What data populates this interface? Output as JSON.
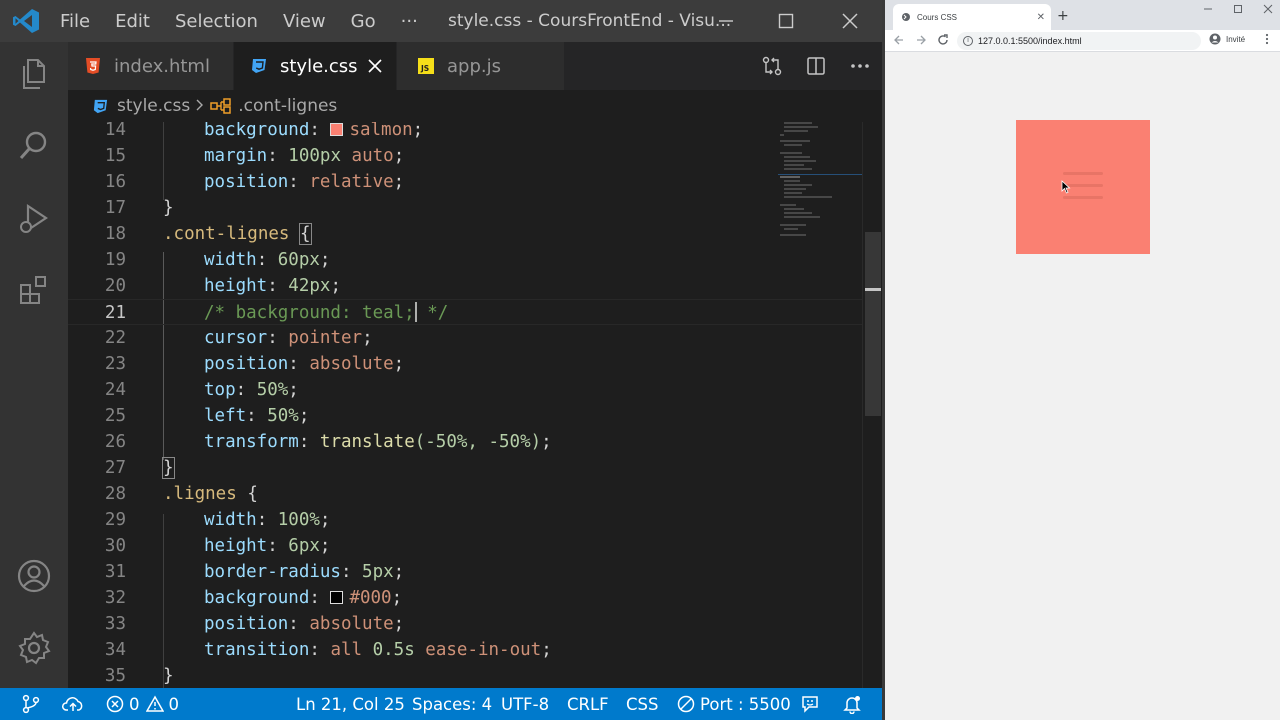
{
  "vscode": {
    "menu": [
      "File",
      "Edit",
      "Selection",
      "View",
      "Go",
      "···"
    ],
    "window_title": "style.css - CoursFrontEnd - Visu...",
    "tabs": [
      {
        "label": "index.html",
        "icon": "html-file-icon"
      },
      {
        "label": "style.css",
        "icon": "css-file-icon",
        "active": true
      },
      {
        "label": "app.js",
        "icon": "js-file-icon"
      }
    ],
    "breadcrumb": {
      "file": "style.css",
      "symbol": ".cont-lignes"
    },
    "line_numbers": [
      "14",
      "15",
      "16",
      "17",
      "18",
      "19",
      "20",
      "21",
      "22",
      "23",
      "24",
      "25",
      "26",
      "27",
      "28",
      "29",
      "30",
      "31",
      "32",
      "33",
      "34",
      "35"
    ],
    "code": {
      "l14": {
        "prop": "background",
        "val": "salmon"
      },
      "l15": {
        "prop": "margin",
        "num": "100px",
        "val": "auto"
      },
      "l16": {
        "prop": "position",
        "val": "relative"
      },
      "l17": {
        "brace": "}"
      },
      "l18": {
        "selector": ".cont-lignes",
        "brace": "{"
      },
      "l19": {
        "prop": "width",
        "num": "60px"
      },
      "l20": {
        "prop": "height",
        "num": "42px"
      },
      "l21": {
        "comment_a": "/* background: teal;",
        "comment_b": " */"
      },
      "l22": {
        "prop": "cursor",
        "val": "pointer"
      },
      "l23": {
        "prop": "position",
        "val": "absolute"
      },
      "l24": {
        "prop": "top",
        "num": "50%"
      },
      "l25": {
        "prop": "left",
        "num": "50%"
      },
      "l26": {
        "prop": "transform",
        "fn": "translate",
        "args": "(-50%, -50%)"
      },
      "l27": {
        "brace": "}"
      },
      "l28": {
        "selector": ".lignes",
        "brace": "{"
      },
      "l29": {
        "prop": "width",
        "num": "100%"
      },
      "l30": {
        "prop": "height",
        "num": "6px"
      },
      "l31": {
        "prop": "border-radius",
        "num": "5px"
      },
      "l32": {
        "prop": "background",
        "val": "#000"
      },
      "l33": {
        "prop": "position",
        "val": "absolute"
      },
      "l34": {
        "prop": "transition",
        "val1": "all",
        "num": "0.5s",
        "val2": "ease-in-out"
      },
      "l35": {
        "brace": "}"
      }
    },
    "status": {
      "errors": "0",
      "warnings": "0",
      "position": "Ln 21, Col 25",
      "spaces": "Spaces: 4",
      "encoding": "UTF-8",
      "eol": "CRLF",
      "language": "CSS",
      "port": "Port : 5500"
    },
    "colors": {
      "salmon_swatch": "#fa8072",
      "black_swatch": "#000000",
      "statusbar": "#007acc"
    }
  },
  "browser": {
    "tab_title": "Cours CSS",
    "new_tab": "+",
    "url": "127.0.0.1:5500/index.html",
    "profile": "Invité",
    "page_box_color": "#fa8072"
  }
}
